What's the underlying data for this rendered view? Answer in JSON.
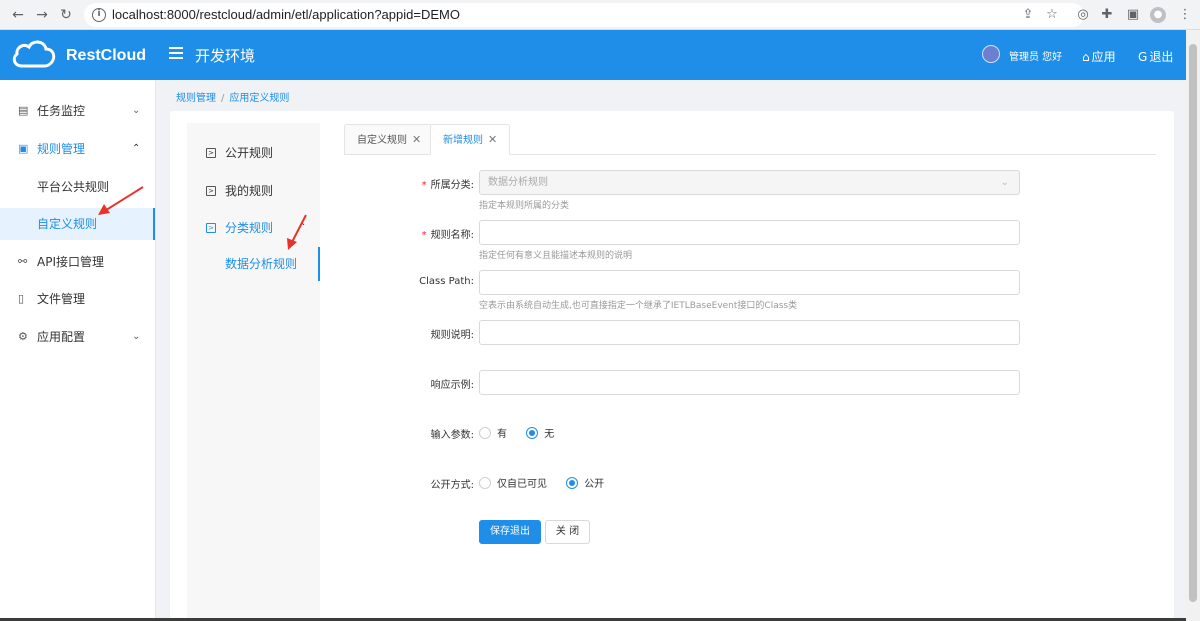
{
  "browser": {
    "url": "localhost:8000/restcloud/admin/etl/application?appid=DEMO"
  },
  "header": {
    "logo_text": "RestCloud",
    "env_title": "开发环境",
    "admin_greeting": "管理员 您好",
    "apps_label": "应用",
    "logout_label": "退出"
  },
  "sidebar": {
    "items": [
      {
        "label": "任务监控"
      },
      {
        "label": "规则管理"
      },
      {
        "label": "平台公共规则"
      },
      {
        "label": "自定义规则"
      },
      {
        "label": "API接口管理"
      },
      {
        "label": "文件管理"
      },
      {
        "label": "应用配置"
      }
    ]
  },
  "breadcrumb": {
    "items": [
      "规则管理",
      "应用定义规则"
    ],
    "separator": "/"
  },
  "submenu": {
    "items": [
      {
        "label": "公开规则"
      },
      {
        "label": "我的规则"
      },
      {
        "label": "分类规则"
      },
      {
        "label": "数据分析规则"
      }
    ]
  },
  "tabs": [
    {
      "label": "自定义规则"
    },
    {
      "label": "新增规则"
    }
  ],
  "form": {
    "category": {
      "label": "所属分类:",
      "value": "数据分析规则",
      "help": "指定本规则所属的分类"
    },
    "name": {
      "label": "规则名称:",
      "value": "",
      "help": "指定任何有意义且能描述本规则的说明"
    },
    "class_path": {
      "label": "Class Path:",
      "value": "",
      "help": "空表示由系统自动生成,也可直接指定一个继承了IETLBaseEvent接口的Class类"
    },
    "description": {
      "label": "规则说明:",
      "value": ""
    },
    "response_example": {
      "label": "响应示例:",
      "value": ""
    },
    "input_params": {
      "label": "输入参数:",
      "options": [
        "有",
        "无"
      ],
      "selected": "无"
    },
    "visibility": {
      "label": "公开方式:",
      "options": [
        "仅自已可见",
        "公开"
      ],
      "selected": "公开"
    },
    "save_label": "保存退出",
    "close_label": "关 闭"
  },
  "colors": {
    "accent": "#1e8ee8",
    "required": "#f5222d",
    "annotation_arrow": "#e8332a"
  }
}
